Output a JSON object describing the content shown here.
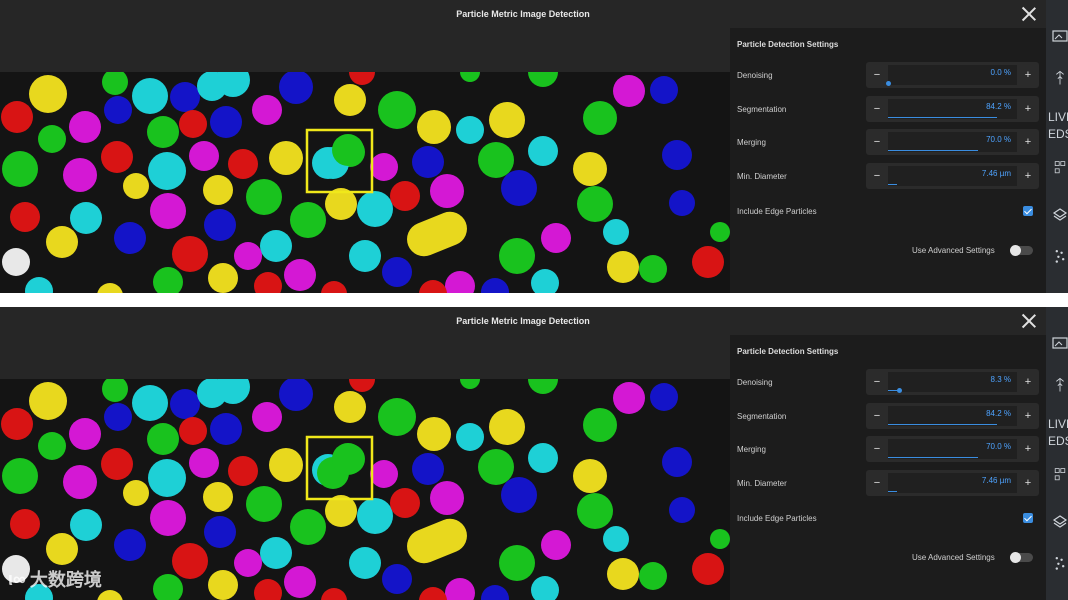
{
  "window": {
    "title": "Particle Metric Image Detection"
  },
  "colors": {
    "accent": "#3a8de0",
    "value_text": "#4ea3ff",
    "highlight_box": "#f0e81a",
    "panel_bg": "#1c1c1c"
  },
  "icons": {
    "close": "close-icon",
    "checkbox": "checkbox-checked-icon"
  },
  "panel": {
    "title": "Particle Detection Settings",
    "edge_label": "Include Edge Particles",
    "edge_checked": true,
    "advanced_label": "Use Advanced Settings",
    "advanced_on": false,
    "minus": "−",
    "plus": "+"
  },
  "frames": [
    {
      "settings": [
        {
          "label": "Denoising",
          "value": "0.0 %",
          "fraction": 0.0
        },
        {
          "label": "Segmentation",
          "value": "84.2 %",
          "fraction": 0.842
        },
        {
          "label": "Merging",
          "value": "70.0 %",
          "fraction": 0.7
        },
        {
          "label": "Min. Diameter",
          "value": "7.46 µm",
          "fraction": 0.07
        }
      ]
    },
    {
      "settings": [
        {
          "label": "Denoising",
          "value": "8.3 %",
          "fraction": 0.083
        },
        {
          "label": "Segmentation",
          "value": "84.2 %",
          "fraction": 0.842
        },
        {
          "label": "Merging",
          "value": "70.0 %",
          "fraction": 0.7
        },
        {
          "label": "Min. Diameter",
          "value": "7.46 µm",
          "fraction": 0.07
        }
      ]
    }
  ],
  "sidebar": {
    "live_label": "LIVE",
    "eds_label": "EDS"
  },
  "watermark": {
    "text": "大数跨境",
    "logo_text": "ι∞"
  }
}
